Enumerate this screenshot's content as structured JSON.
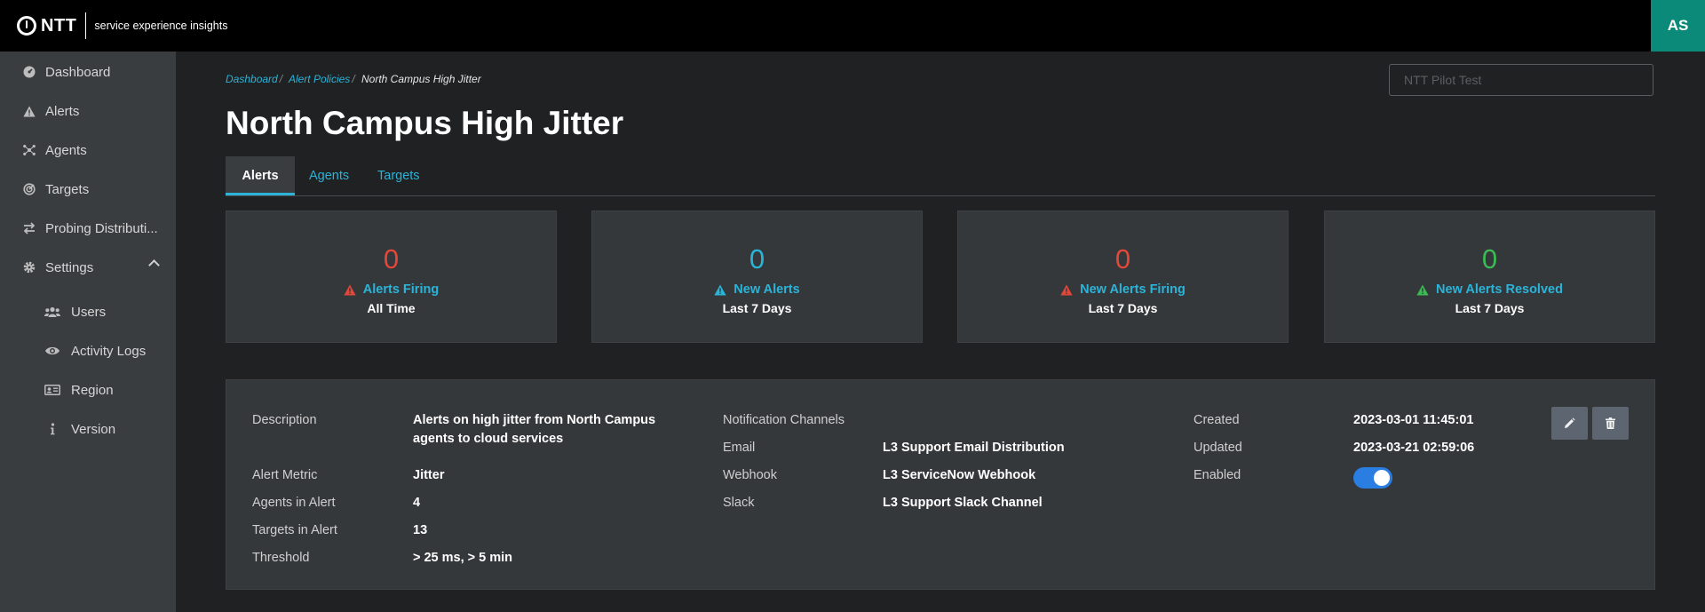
{
  "brand": {
    "name": "NTT",
    "subtitle": "service experience insights"
  },
  "user": {
    "initials": "AS"
  },
  "sidebar": {
    "items": [
      {
        "label": "Dashboard",
        "icon": "dashboard-icon"
      },
      {
        "label": "Alerts",
        "icon": "warning-icon"
      },
      {
        "label": "Agents",
        "icon": "agents-icon"
      },
      {
        "label": "Targets",
        "icon": "target-icon"
      },
      {
        "label": "Probing Distributi...",
        "icon": "swap-icon"
      },
      {
        "label": "Settings",
        "icon": "gear-icon",
        "expanded": true
      }
    ],
    "settings_items": [
      {
        "label": "Users",
        "icon": "users-icon"
      },
      {
        "label": "Activity Logs",
        "icon": "eye-icon"
      },
      {
        "label": "Region",
        "icon": "id-card-icon"
      },
      {
        "label": "Version",
        "icon": "info-icon"
      }
    ]
  },
  "breadcrumb": {
    "items": [
      "Dashboard",
      "Alert Policies"
    ],
    "current": "North Campus High Jitter"
  },
  "search": {
    "placeholder": "NTT Pilot Test"
  },
  "page": {
    "title": "North Campus High Jitter"
  },
  "tabs": [
    {
      "label": "Alerts",
      "active": true
    },
    {
      "label": "Agents",
      "active": false
    },
    {
      "label": "Targets",
      "active": false
    }
  ],
  "stats": [
    {
      "value": "0",
      "label": "Alerts Firing",
      "period": "All Time",
      "color": "#e0483a",
      "icon": "warning-red-icon"
    },
    {
      "value": "0",
      "label": "New Alerts",
      "period": "Last 7 Days",
      "color": "#2bb3d8",
      "icon": "warning-blue-icon"
    },
    {
      "value": "0",
      "label": "New Alerts Firing",
      "period": "Last 7 Days",
      "color": "#e0483a",
      "icon": "warning-red-icon"
    },
    {
      "value": "0",
      "label": "New Alerts Resolved",
      "period": "Last 7 Days",
      "color": "#3cba54",
      "icon": "warning-green-icon"
    }
  ],
  "details": {
    "left": [
      {
        "label": "Description",
        "value": "Alerts on high jitter from North Campus agents to cloud services"
      },
      {
        "label": "Alert Metric",
        "value": "Jitter"
      },
      {
        "label": "Agents in Alert",
        "value": "4"
      },
      {
        "label": "Targets in Alert",
        "value": "13"
      },
      {
        "label": "Threshold",
        "value": "> 25 ms, > 5 min"
      }
    ],
    "notifications_heading": "Notification Channels",
    "notifications": [
      {
        "label": "Email",
        "value": "L3 Support Email Distribution"
      },
      {
        "label": "Webhook",
        "value": "L3 ServiceNow Webhook"
      },
      {
        "label": "Slack",
        "value": "L3 Support Slack Channel"
      }
    ],
    "right": [
      {
        "label": "Created",
        "value": "2023-03-01 11:45:01"
      },
      {
        "label": "Updated",
        "value": "2023-03-21 02:59:06"
      }
    ],
    "enabled_label": "Enabled",
    "enabled": true
  },
  "colors": {
    "accent": "#2bb3d8",
    "toggle": "#2a7de1",
    "avatar_bg": "#0b8a79"
  }
}
